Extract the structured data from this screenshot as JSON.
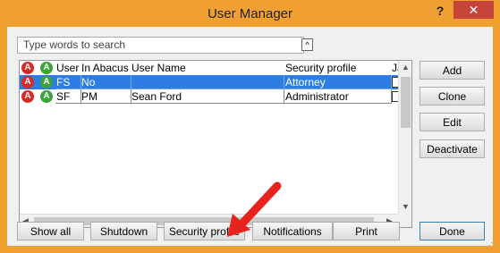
{
  "window": {
    "title": "User Manager",
    "help_label": "?",
    "close_label": "✕"
  },
  "search": {
    "placeholder": "Type words to search",
    "collapse_label": "^"
  },
  "grid": {
    "columns": [
      "User",
      "In Abacus",
      "User Name",
      "Security profile",
      "Ja"
    ],
    "header_icons": [
      "A",
      "A"
    ],
    "rows": [
      {
        "user": "FS",
        "in_abacus": "No",
        "user_name": "",
        "security_profile": "Attorney",
        "selected": true
      },
      {
        "user": "SF",
        "in_abacus": "PM",
        "user_name": "Sean Ford",
        "security_profile": "Administrator",
        "selected": false
      }
    ],
    "scroll_arrows": {
      "up": "▲",
      "down": "▼",
      "left": "◀",
      "right": "▶"
    }
  },
  "side_buttons": {
    "add": "Add",
    "clone": "Clone",
    "edit": "Edit",
    "deactivate": "Deactivate"
  },
  "bottom_buttons": {
    "show_all": "Show all",
    "shutdown": "Shutdown",
    "security_profile": "Security profile",
    "notifications": "Notifications",
    "print": "Print",
    "done": "Done"
  },
  "colors": {
    "window_frame": "#f0a030",
    "close": "#c7443a",
    "selection": "#2d7de3",
    "pointer_arrow": "#e8231d",
    "icon_red": "#d62a2a",
    "icon_green": "#3aa33a"
  },
  "icons": [
    "alert-red-icon",
    "alert-green-icon",
    "red-pointer-arrow-icon"
  ]
}
